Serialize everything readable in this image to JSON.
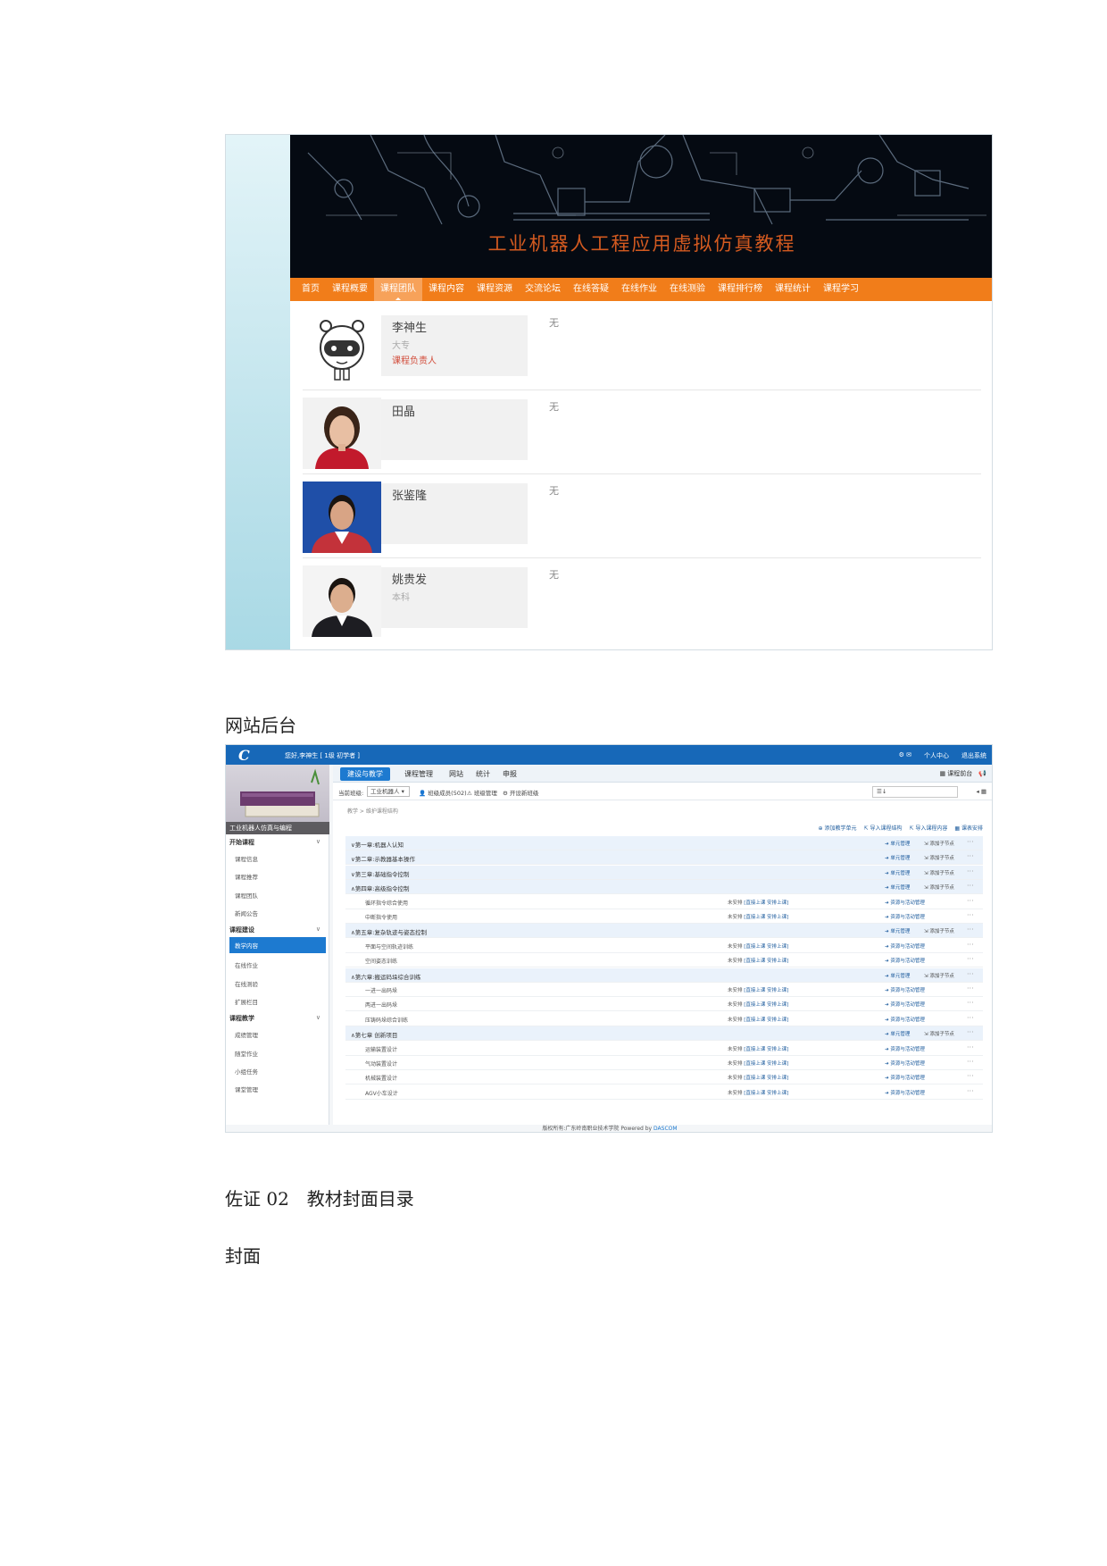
{
  "course_site": {
    "banner_title": "工业机器人工程应用虚拟仿真教程",
    "nav": [
      "首页",
      "课程概要",
      "课程团队",
      "课程内容",
      "课程资源",
      "交流论坛",
      "在线答疑",
      "在线作业",
      "在线测验",
      "课程排行榜",
      "课程统计",
      "课程学习"
    ],
    "active_nav": "课程团队",
    "members": [
      {
        "name": "李神生",
        "education": "大专",
        "role": "课程负责人",
        "description": "无"
      },
      {
        "name": "田晶",
        "education": "",
        "role": "",
        "description": "无"
      },
      {
        "name": "张鉴隆",
        "education": "",
        "role": "",
        "description": "无"
      },
      {
        "name": "姚贵发",
        "education": "本科",
        "role": "",
        "description": "无"
      }
    ]
  },
  "captions": {
    "backend": "网站后台",
    "evidence": "佐证 02　教材封面目录",
    "cover": "封面"
  },
  "admin": {
    "logo": "C",
    "greeting": "您好,李神生 [ 1级 初学者 ]",
    "top_right": [
      "个人中心",
      "退出系统"
    ],
    "tabs": [
      "建设与教学",
      "课程管理",
      "网站",
      "统计",
      "申报"
    ],
    "active_tab": "建设与教学",
    "tab_right": "课程前台",
    "toolbar": {
      "course_label": "当前班级:",
      "course_value": "工业机器人",
      "items": [
        "班级成员(502)",
        "班级管理",
        "开设新班级"
      ]
    },
    "course_cover_title": "工业机器人仿真与编程",
    "sidebar": [
      {
        "group": "开始课程",
        "items": [
          "课程信息",
          "课程推荐",
          "课程团队",
          "新闻公告"
        ]
      },
      {
        "group": "课程建设",
        "items": [
          "教学内容",
          "在线作业",
          "在线测验",
          "扩展栏目"
        ]
      },
      {
        "group": "课程教学",
        "items": [
          "成绩管理",
          "随堂作业",
          "小组任务",
          "课堂管理"
        ]
      }
    ],
    "active_side_item": "教学内容",
    "breadcrumb": "教学 > 维护课程结构",
    "actions": [
      "添加教学单元",
      "导入课程结构",
      "导入课程内容",
      "课表安排"
    ],
    "row_status_label": "未安排",
    "row_status_links": "[直接上课 安排上课]",
    "chapter_action_1": "单元管理",
    "chapter_action_2": "添加子节点",
    "section_action": "资源与活动管理",
    "rows": [
      {
        "type": "chapter",
        "title": "∨第一章:机器人认知"
      },
      {
        "type": "chapter",
        "title": "∨第二章:示教器基本操作"
      },
      {
        "type": "chapter",
        "title": "∨第三章:基础指令控制"
      },
      {
        "type": "chapter",
        "title": "∧第四章:高级指令控制"
      },
      {
        "type": "section",
        "title": "循环指令综合使用"
      },
      {
        "type": "section",
        "title": "中断指令使用"
      },
      {
        "type": "chapter",
        "title": "∧第五章:复杂轨迹与姿态控制"
      },
      {
        "type": "section",
        "title": "平面与空间轨迹训练"
      },
      {
        "type": "section",
        "title": "空间姿态训练"
      },
      {
        "type": "chapter",
        "title": "∧第六章:搬运码垛综合训练"
      },
      {
        "type": "section",
        "title": "一进一出码垛"
      },
      {
        "type": "section",
        "title": "两进一出码垛"
      },
      {
        "type": "section",
        "title": "压铸码垛综合训练"
      },
      {
        "type": "chapter",
        "title": "∧第七章 创新项目"
      },
      {
        "type": "section",
        "title": "运输装置设计"
      },
      {
        "type": "section",
        "title": "气动装置设计"
      },
      {
        "type": "section",
        "title": "机械装置设计"
      },
      {
        "type": "section",
        "title": "AGV小车设计"
      }
    ],
    "footer_prefix": "版权所有:广东岭南职业技术学院 Powered by",
    "footer_brand": "DASCOM"
  }
}
